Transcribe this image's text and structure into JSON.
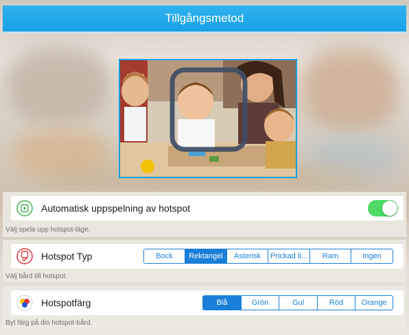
{
  "header": {
    "title": "Tillgångsmetod"
  },
  "autoplay": {
    "label": "Automatisk uppspelning av hotspot",
    "hint": "Välj spela upp hotspot-läge.",
    "enabled": true
  },
  "hotspot_type": {
    "label": "Hotspot Typ",
    "hint": "Välj bård till hotspot.",
    "options": [
      "Bock",
      "Rektangel",
      "Asterisk",
      "Prickad li...",
      "Ram",
      "Ingen"
    ],
    "selected": "Rektangel"
  },
  "hotspot_color": {
    "label": "Hotspotfärg",
    "hint": "Byt färg på din hotspot-bård.",
    "options": [
      "Blå",
      "Grön",
      "Gul",
      "Röd",
      "Orange"
    ],
    "selected": "Blå"
  },
  "colors": {
    "accent": "#1a7fd8",
    "header": "#1ea5e9",
    "toggle_on": "#4cd964",
    "autoplay_icon": "#3fb34f",
    "type_icon": "#e0383e"
  },
  "icons": {
    "autoplay": "play-in-square-icon",
    "type": "checked-box-icon",
    "color": "color-dots-icon"
  }
}
